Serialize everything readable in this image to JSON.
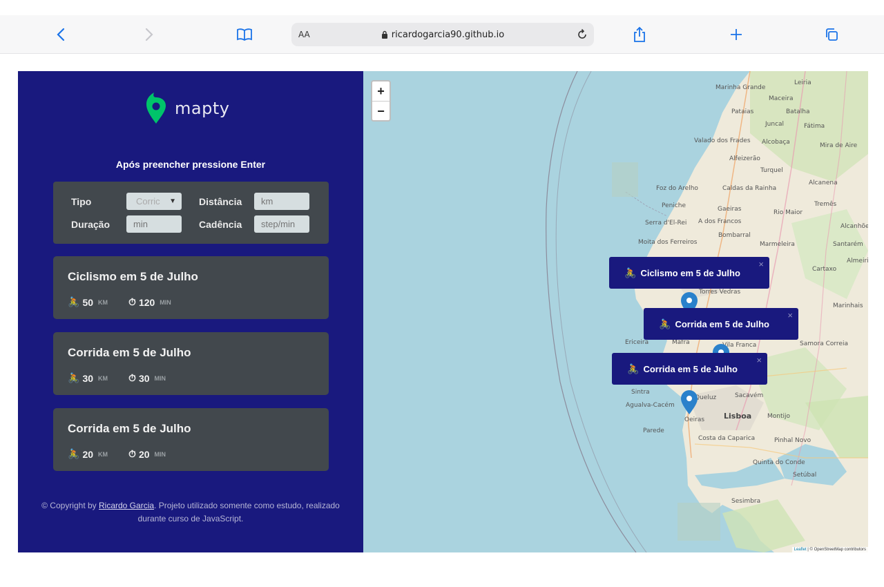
{
  "browser": {
    "text_size": "AA",
    "url": "ricardogarcia90.github.io"
  },
  "app": {
    "logo_text": "mapty",
    "hint": "Após preencher pressione Enter"
  },
  "form": {
    "type_label": "Tipo",
    "type_value": "Corric",
    "distance_label": "Distância",
    "distance_placeholder": "km",
    "duration_label": "Duração",
    "duration_placeholder": "min",
    "cadence_label": "Cadência",
    "cadence_placeholder": "step/min"
  },
  "workouts": [
    {
      "title": "Ciclismo em 5 de Julho",
      "distance": "50",
      "distance_unit": "KM",
      "duration": "120",
      "duration_unit": "MIN"
    },
    {
      "title": "Corrida em 5 de Julho",
      "distance": "30",
      "distance_unit": "KM",
      "duration": "30",
      "duration_unit": "MIN"
    },
    {
      "title": "Corrida em 5 de Julho",
      "distance": "20",
      "distance_unit": "KM",
      "duration": "20",
      "duration_unit": "MIN"
    }
  ],
  "footer": {
    "prefix": "© Copyright by ",
    "author": "Ricardo Garcia",
    "suffix": ". Projeto utilizado somente como estudo, realizado durante curso de JavaScript."
  },
  "map": {
    "zoom_in": "+",
    "zoom_out": "−",
    "attribution_leaflet": "Leaflet",
    "attribution_rest": " | © OpenStreetMap contributors",
    "popups": [
      {
        "label": "Ciclismo em 5 de Julho"
      },
      {
        "label": "Corrida em 5 de Julho"
      },
      {
        "label": "Corrida em 5 de Julho"
      }
    ],
    "places": [
      "Leiria",
      "Marinha Grande",
      "Maceira",
      "Pataias",
      "Batalha",
      "Juncal",
      "Fátima",
      "Valado dos Frades",
      "Alcobaça",
      "Mira de Aire",
      "Alfeizerão",
      "Turquel",
      "Alcanena",
      "Foz do Arelho",
      "Caldas da Rainha",
      "Peniche",
      "Gaeiras",
      "Rio Maior",
      "Tremês",
      "Serra d'El-Rei",
      "A dos Francos",
      "Alcanhões",
      "Bombarral",
      "Moita dos Ferreiros",
      "Marmeleira",
      "Santarém",
      "Almeirim",
      "Cartaxo",
      "Torres Vedras",
      "Marinhais",
      "Ericeira",
      "Mafra",
      "Vila Franca",
      "Samora Correia",
      "Sintra",
      "Agualva-Cacém",
      "Queluz",
      "Sacavém",
      "Lisboa",
      "Montijo",
      "Oeiras",
      "Parede",
      "Costa da Caparica",
      "Pinhal Novo",
      "Quinta do Conde",
      "Setúbal",
      "Sesimbra"
    ]
  },
  "colors": {
    "sidebar": "#19197e",
    "card": "#42484d",
    "logo_green": "#00c46a",
    "sea": "#aad3df",
    "marker": "#2a81cb"
  }
}
